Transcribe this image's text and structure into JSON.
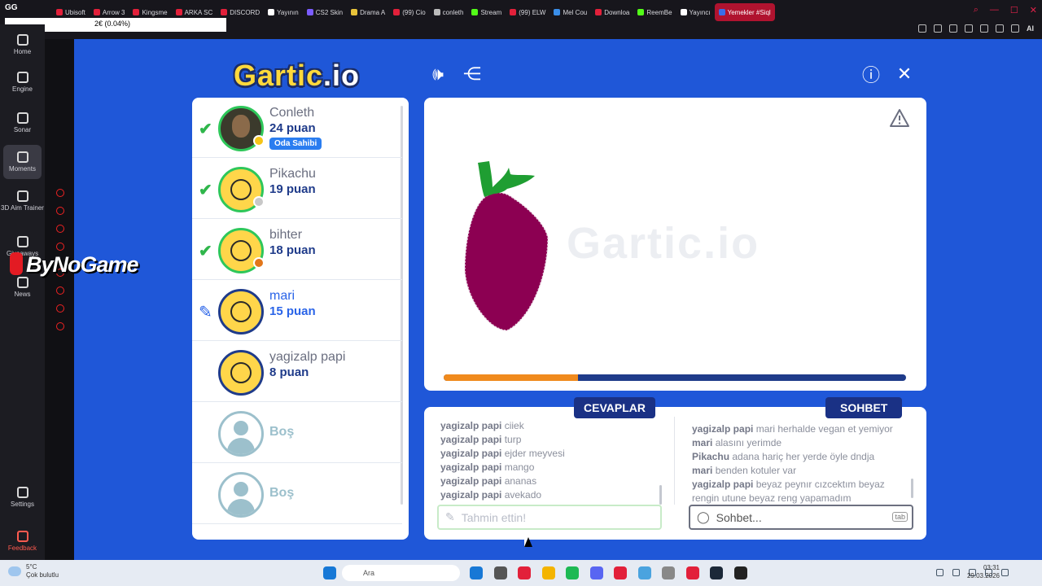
{
  "browser": {
    "gg_label": "GG",
    "status_text": "2€ (0.04%)",
    "tabs": [
      {
        "label": "Ubisoft",
        "color": "#e2203a"
      },
      {
        "label": "Arrow 3",
        "color": "#e2203a"
      },
      {
        "label": "Kingsme",
        "color": "#e2203a"
      },
      {
        "label": "ARKA SC",
        "color": "#e2203a"
      },
      {
        "label": "DISCORD",
        "color": "#e2203a"
      },
      {
        "label": "Yayının",
        "color": "#ffffff"
      },
      {
        "label": "CS2 Skin",
        "color": "#7b5cff"
      },
      {
        "label": "Drama A",
        "color": "#e8c33a"
      },
      {
        "label": "(99) Cio",
        "color": "#e2203a"
      },
      {
        "label": "conleth",
        "color": "#bbbbbb"
      },
      {
        "label": "Stream",
        "color": "#53fc18"
      },
      {
        "label": "(99) ELW",
        "color": "#e2203a"
      },
      {
        "label": "Mel Cou",
        "color": "#3a8ee8"
      },
      {
        "label": "Downloa",
        "color": "#e2203a"
      },
      {
        "label": "ReemBe",
        "color": "#53fc18"
      },
      {
        "label": "Yayıncı",
        "color": "#ffffff"
      },
      {
        "label": "Yemekler #Siql",
        "color": "#3a6ee8",
        "active": true
      }
    ],
    "ai_label": "AI"
  },
  "sidebar": {
    "items": [
      {
        "label": "Home"
      },
      {
        "label": "Engine"
      },
      {
        "label": "Sonar"
      },
      {
        "label": "Moments",
        "active": true
      },
      {
        "label": "3D Aim Trainer"
      },
      {
        "label": "Giveaways"
      },
      {
        "label": "News"
      },
      {
        "label": "Settings"
      },
      {
        "label": "Feedback"
      }
    ]
  },
  "watermark": {
    "text": "ByNoGame"
  },
  "game": {
    "logo_main": "Gartic",
    "logo_suffix": ".io",
    "ghost_logo": "Gartic.io",
    "players": [
      {
        "name": "Conleth",
        "score": "24 puan",
        "status": "guessed",
        "badge": "Oda Sahibi",
        "dot_color": "#f5c518"
      },
      {
        "name": "Pikachu",
        "score": "19 puan",
        "status": "guessed",
        "dot_color": "#c8c8c8"
      },
      {
        "name": "bihter",
        "score": "18 puan",
        "status": "guessed",
        "dot_color": "#e2761a"
      },
      {
        "name": "mari",
        "score": "15 puan",
        "status": "drawing"
      },
      {
        "name": "yagizalp papi",
        "score": "8 puan",
        "status": "none"
      },
      {
        "name": "Boş",
        "status": "empty"
      },
      {
        "name": "Boş",
        "status": "empty"
      }
    ],
    "round_progress": 0.29,
    "answers_tab_label": "CEVAPLAR",
    "chat_tab_label": "SOHBET",
    "answers": [
      {
        "user": "yagizalp papi",
        "text": "ciiek"
      },
      {
        "user": "yagizalp papi",
        "text": "turp"
      },
      {
        "user": "yagizalp papi",
        "text": "ejder meyvesi"
      },
      {
        "user": "yagizalp papi",
        "text": "mango"
      },
      {
        "user": "yagizalp papi",
        "text": "ananas"
      },
      {
        "user": "yagizalp papi",
        "text": "avekado"
      }
    ],
    "chat": [
      {
        "user": "yagizalp papi",
        "text": "mari herhalde vegan et yemiyor"
      },
      {
        "user": "mari",
        "text": "alasını yerimde"
      },
      {
        "user": "Pikachu",
        "text": "adana hariç her yerde öyle dndja"
      },
      {
        "user": "mari",
        "text": "benden kotuler var"
      },
      {
        "user": "yagizalp papi",
        "text": "beyaz peynır cızcektım beyaz rengin utune beyaz reng yapamadım"
      }
    ],
    "guess_placeholder": "Tahmin ettin!",
    "chat_placeholder": "Sohbet...",
    "tab_key": "tab"
  },
  "taskbar": {
    "weather_temp": "5°C",
    "weather_desc": "Çok bulutlu",
    "search_placeholder": "Ara",
    "time": "03:31",
    "date": "29.03.2026",
    "app_colors": [
      "#1778d6",
      "#555555",
      "#e2203a",
      "#f4b400",
      "#1db954",
      "#5865f2",
      "#e2203a",
      "#4aa3df",
      "#888888",
      "#e2203a",
      "#1b2838",
      "#222222"
    ]
  }
}
